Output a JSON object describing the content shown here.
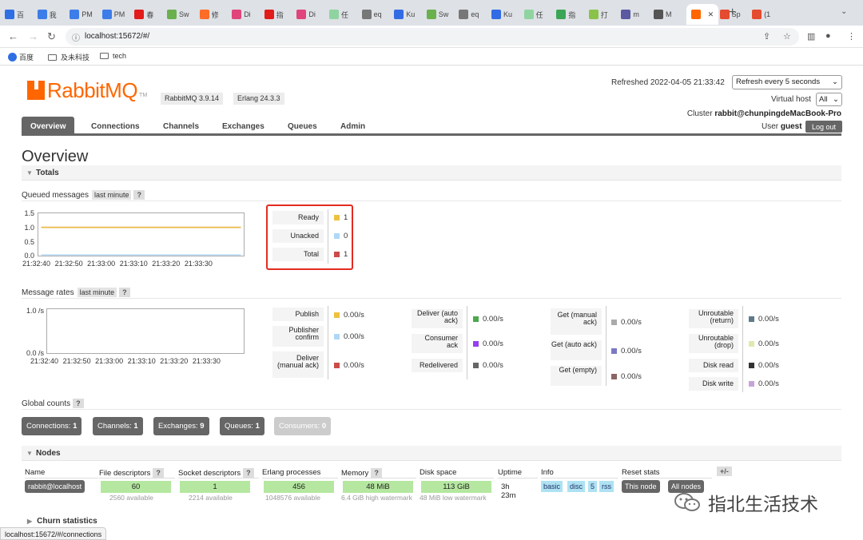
{
  "browser": {
    "tabs": [
      {
        "label": "百",
        "color": "#2f6fe4"
      },
      {
        "label": "我",
        "color": "#3d7de9"
      },
      {
        "label": "PM",
        "color": "#3d7de9"
      },
      {
        "label": "PM",
        "color": "#3d7de9"
      },
      {
        "label": "春",
        "color": "#e21b1b"
      },
      {
        "label": "Sw",
        "color": "#6ab04c"
      },
      {
        "label": "修",
        "color": "#fc6d26"
      },
      {
        "label": "Di",
        "color": "#e0447a"
      },
      {
        "label": "指",
        "color": "#e21b1b"
      },
      {
        "label": "Di",
        "color": "#e0447a"
      },
      {
        "label": "任",
        "color": "#8fd4a0"
      },
      {
        "label": "eq",
        "color": "#777"
      },
      {
        "label": "Ku",
        "color": "#326ce5"
      },
      {
        "label": "Sw",
        "color": "#6ab04c"
      },
      {
        "label": "eq",
        "color": "#777"
      },
      {
        "label": "Ku",
        "color": "#326ce5"
      },
      {
        "label": "任",
        "color": "#8fd4a0"
      },
      {
        "label": "指",
        "color": "#3aa655"
      },
      {
        "label": "打",
        "color": "#8bc34a"
      },
      {
        "label": "m",
        "color": "#5a5aa0"
      },
      {
        "label": "M",
        "color": "#555"
      }
    ],
    "active_tab": {
      "label": "",
      "color": "#f60"
    },
    "after_tabs": [
      {
        "label": "Sp",
        "color": "#e54b2e"
      },
      {
        "label": "(1",
        "color": "#e54b2e"
      }
    ],
    "url": "localhost:15672/#/",
    "bookmarks": [
      "百度",
      "及未科技",
      "tech"
    ],
    "status_url": "localhost:15672/#/connections"
  },
  "header": {
    "logo_text": "RabbitMQ",
    "logo_tm": "TM",
    "version": "RabbitMQ 3.9.14",
    "erlang": "Erlang 24.3.3",
    "refreshed": "Refreshed 2022-04-05 21:33:42",
    "refresh_option": "Refresh every 5 seconds",
    "vhost_label": "Virtual host",
    "vhost_value": "All",
    "cluster_label": "Cluster",
    "cluster_name": "rabbit@chunpingdeMacBook-Pro",
    "user_label": "User",
    "user_name": "guest",
    "logout": "Log out"
  },
  "nav_tabs": [
    "Overview",
    "Connections",
    "Channels",
    "Exchanges",
    "Queues",
    "Admin"
  ],
  "overview": {
    "title": "Overview",
    "totals_label": "Totals",
    "queued_label": "Queued messages",
    "queued_range": "last minute",
    "help": "?",
    "queued_legend": [
      {
        "label": "Ready",
        "value": "1",
        "color": "#edc240"
      },
      {
        "label": "Unacked",
        "value": "0",
        "color": "#afd8f8"
      },
      {
        "label": "Total",
        "value": "1",
        "color": "#cb4b4b"
      }
    ],
    "rates_label": "Message rates",
    "rates_range": "last minute",
    "rates": [
      {
        "label": "Publish",
        "value": "0.00/s",
        "color": "#edc240"
      },
      {
        "label": "Publisher confirm",
        "value": "0.00/s",
        "color": "#afd8f8"
      },
      {
        "label": "Deliver (manual ack)",
        "value": "0.00/s",
        "color": "#cb4b4b"
      },
      {
        "label": "Deliver (auto ack)",
        "value": "0.00/s",
        "color": "#4da74d"
      },
      {
        "label": "Consumer ack",
        "value": "0.00/s",
        "color": "#9440ed"
      },
      {
        "label": "Redelivered",
        "value": "0.00/s",
        "color": "#666666"
      },
      {
        "label": "Get (manual ack)",
        "value": "0.00/s",
        "color": "#aaaaaa"
      },
      {
        "label": "Get (auto ack)",
        "value": "0.00/s",
        "color": "#7c79c3"
      },
      {
        "label": "Get (empty)",
        "value": "0.00/s",
        "color": "#8c6565"
      },
      {
        "label": "Unroutable (return)",
        "value": "0.00/s",
        "color": "#5e7a8a"
      },
      {
        "label": "Unroutable (drop)",
        "value": "0.00/s",
        "color": "#e0e8b0"
      },
      {
        "label": "Disk read",
        "value": "0.00/s",
        "color": "#333333"
      },
      {
        "label": "Disk write",
        "value": "0.00/s",
        "color": "#c6a5d6"
      }
    ],
    "global_label": "Global counts",
    "global_counts": [
      {
        "label": "Connections:",
        "value": "1"
      },
      {
        "label": "Channels:",
        "value": "1"
      },
      {
        "label": "Exchanges:",
        "value": "9"
      },
      {
        "label": "Queues:",
        "value": "1"
      },
      {
        "label": "Consumers:",
        "value": "0"
      }
    ],
    "nodes_label": "Nodes",
    "churn_label": "Churn statistics"
  },
  "nodes": {
    "headers": [
      "Name",
      "File descriptors",
      "Socket descriptors",
      "Erlang processes",
      "Memory",
      "Disk space",
      "Uptime",
      "Info",
      "Reset stats"
    ],
    "plusminus": "+/-",
    "row": {
      "name": "rabbit@localhost",
      "fd": "60",
      "fd_sub": "2560 available",
      "sd": "1",
      "sd_sub": "2214 available",
      "ep": "456",
      "ep_sub": "1048576 available",
      "mem": "48 MiB",
      "mem_sub": "6.4 GiB high watermark",
      "disk": "113 GiB",
      "disk_sub": "48 MiB low watermark",
      "uptime": "3h 23m",
      "info": [
        "basic",
        "disc",
        "5",
        "rss"
      ],
      "this_node": "This node",
      "all_nodes": "All nodes"
    }
  },
  "watermark": "指北生活技术",
  "chart_data": [
    {
      "type": "line",
      "title": "Queued messages",
      "x": [
        "21:32:40",
        "21:32:50",
        "21:33:00",
        "21:33:10",
        "21:33:20",
        "21:33:30"
      ],
      "yticks": [
        "1.5",
        "1.0",
        "0.5",
        "0.0"
      ],
      "ylim": [
        0,
        1.5
      ],
      "series": [
        {
          "name": "Ready",
          "values": [
            1,
            1,
            1,
            1,
            1,
            1
          ],
          "color": "#edc240"
        },
        {
          "name": "Unacked",
          "values": [
            0,
            0,
            0,
            0,
            0,
            0
          ],
          "color": "#afd8f8"
        },
        {
          "name": "Total",
          "values": [
            1,
            1,
            1,
            1,
            1,
            1
          ],
          "color": "#cb4b4b"
        }
      ]
    },
    {
      "type": "line",
      "title": "Message rates",
      "x": [
        "21:32:40",
        "21:32:50",
        "21:33:00",
        "21:33:10",
        "21:33:20",
        "21:33:30"
      ],
      "yticks": [
        "1.0 /s",
        "0.0 /s"
      ],
      "ylim": [
        0,
        1
      ],
      "series": []
    }
  ]
}
